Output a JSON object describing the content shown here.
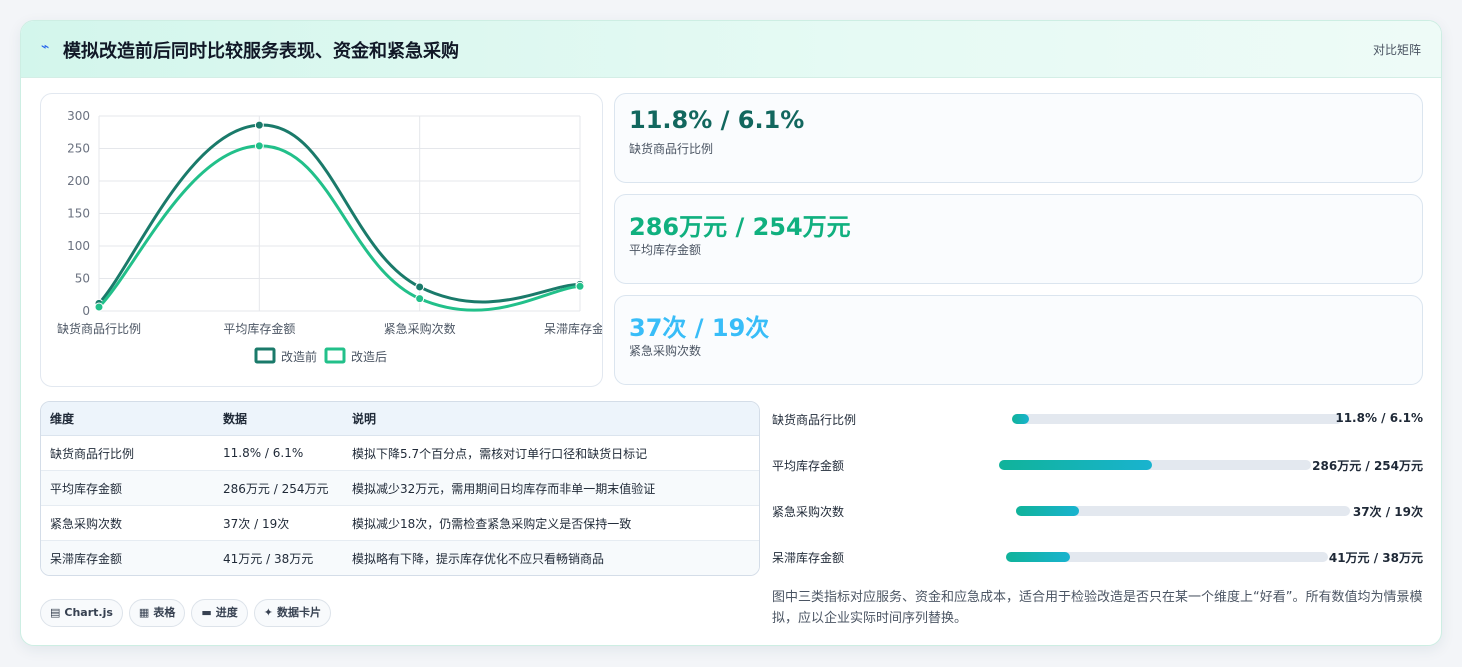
{
  "header": {
    "icon": "lightning-icon",
    "title": "模拟改造前后同时比较服务表现、资金和紧急采购",
    "tag": "对比矩阵"
  },
  "chart_data": {
    "type": "line",
    "categories": [
      "缺货商品行比例",
      "平均库存金额",
      "紧急采购次数",
      "呆滞库存金额"
    ],
    "series": [
      {
        "name": "改造前",
        "values": [
          11.8,
          286,
          37,
          41
        ],
        "color": "#1a7a6a"
      },
      {
        "name": "改造后",
        "values": [
          6.1,
          254,
          19,
          38
        ],
        "color": "#22c08a"
      }
    ],
    "yticks": [
      0,
      50,
      100,
      150,
      200,
      250,
      300
    ],
    "ylim": [
      0,
      300
    ],
    "legend": "bottom",
    "grid": true
  },
  "stats": [
    {
      "value": "11.8% / 6.1%",
      "label": "缺货商品行比例",
      "color": "#12675e"
    },
    {
      "value": "286万元 / 254万元",
      "label": "平均库存金额",
      "color": "#10b07f"
    },
    {
      "value": "37次 / 19次",
      "label": "紧急采购次数",
      "color": "#38bdf8"
    }
  ],
  "table": {
    "headers": [
      "维度",
      "数据",
      "说明"
    ],
    "rows": [
      [
        "缺货商品行比例",
        "11.8% / 6.1%",
        "模拟下降5.7个百分点，需核对订单行口径和缺货日标记"
      ],
      [
        "平均库存金额",
        "286万元 / 254万元",
        "模拟减少32万元，需用期间日均库存而非单一期末值验证"
      ],
      [
        "紧急采购次数",
        "37次 / 19次",
        "模拟减少18次，仍需检查紧急采购定义是否保持一致"
      ],
      [
        "呆滞库存金额",
        "41万元 / 38万元",
        "模拟略有下降，提示库存优化不应只看畅销商品"
      ]
    ]
  },
  "progress": [
    {
      "label": "缺货商品行比例",
      "value": "11.8% / 6.1%",
      "fraction": 0.05
    },
    {
      "label": "平均库存金额",
      "value": "286万元 / 254万元",
      "fraction": 0.49
    },
    {
      "label": "紧急采购次数",
      "value": "37次 / 19次",
      "fraction": 0.19
    },
    {
      "label": "呆滞库存金额",
      "value": "41万元 / 38万元",
      "fraction": 0.2
    }
  ],
  "note": "图中三类指标对应服务、资金和应急成本，适合用于检验改造是否只在某一个维度上“好看”。所有数值均为情景模拟，应以企业实际时间序列替换。",
  "chips": [
    {
      "icon": "chart-icon",
      "glyph": "▤",
      "label": "Chart.js"
    },
    {
      "icon": "table-icon",
      "glyph": "▦",
      "label": "表格"
    },
    {
      "icon": "progress-icon",
      "glyph": "▬",
      "label": "进度"
    },
    {
      "icon": "sparkle-icon",
      "glyph": "✦",
      "label": "数据卡片"
    }
  ]
}
